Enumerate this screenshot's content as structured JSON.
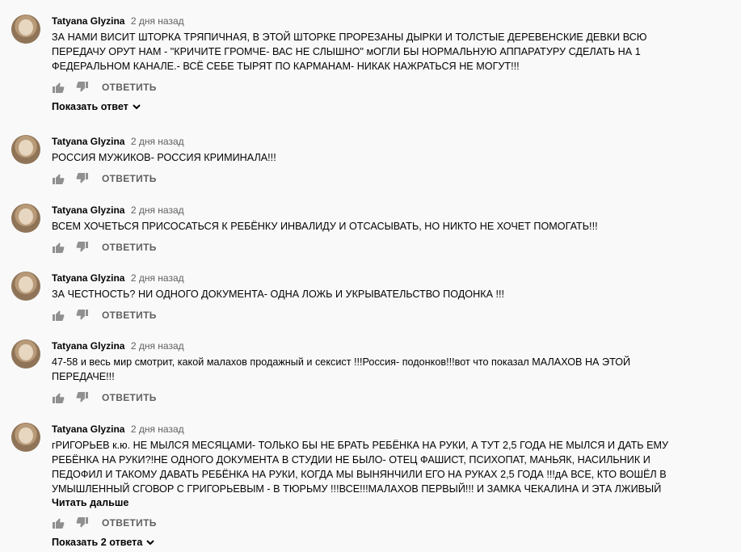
{
  "comments": [
    {
      "author": "Tatyana Glyzina",
      "time": "2 дня назад",
      "lines": [
        "ЗА НАМИ ВИСИТ ШТОРКА ТРЯПИЧНАЯ, В ЭТОЙ ШТОРКЕ ПРОРЕЗАНЫ ДЫРКИ И ТОЛСТЫЕ ДЕРЕВЕНСКИЕ ДЕВКИ ВСЮ",
        "ПЕРЕДАЧУ ОРУТ НАМ - \"КРИЧИТЕ ГРОМЧЕ- ВАС НЕ СЛЫШНО\" мОГЛИ БЫ НОРМАЛЬНУЮ АППАРАТУРУ СДЕЛАТЬ НА 1",
        "ФЕДЕРАЛЬНОМ КАНАЛЕ.- ВСЁ СЕБЕ ТЫРЯТ ПО КАРМАНАМ- НИКАК НАЖРАТЬСЯ НЕ МОГУТ!!!"
      ],
      "reply_label": "ОТВЕТИТЬ",
      "replies_label": "Показать ответ"
    },
    {
      "author": "Tatyana Glyzina",
      "time": "2 дня назад",
      "lines": [
        "РОССИЯ МУЖИКОВ- РОССИЯ КРИМИНАЛА!!!"
      ],
      "reply_label": "ОТВЕТИТЬ"
    },
    {
      "author": "Tatyana Glyzina",
      "time": "2 дня назад",
      "lines": [
        "ВСЕМ ХОЧЕТЬСЯ ПРИСОСАТЬСЯ К РЕБЁНКУ ИНВАЛИДУ И ОТСАСЫВАТЬ, НО НИКТО НЕ ХОЧЕТ ПОМОГАТЬ!!!"
      ],
      "reply_label": "ОТВЕТИТЬ"
    },
    {
      "author": "Tatyana Glyzina",
      "time": "2 дня назад",
      "lines": [
        "ЗА ЧЕСТНОСТЬ? НИ ОДНОГО ДОКУМЕНТА- ОДНА ЛОЖЬ И УКРЫВАТЕЛЬСТВО ПОДОНКА !!!"
      ],
      "reply_label": "ОТВЕТИТЬ"
    },
    {
      "author": "Tatyana Glyzina",
      "time": "2 дня назад",
      "lines": [
        "47-58  и весь мир смотрит, какой малахов продажный и сексист !!!Россия- подонков!!!вот что показал МАЛАХОВ НА ЭТОЙ",
        "ПЕРЕДАЧЕ!!!"
      ],
      "reply_label": "ОТВЕТИТЬ"
    },
    {
      "author": "Tatyana Glyzina",
      "time": "2 дня назад",
      "lines": [
        "гРИГОРЬЕВ к.ю. НЕ МЫЛСЯ МЕСЯЦАМИ- ТОЛЬКО БЫ НЕ БРАТЬ РЕБЁНКА НА РУКИ, А ТУТ 2,5 ГОДА НЕ МЫЛСЯ И ДАТЬ ЕМУ",
        "РЕБЁНКА НА РУКИ?!НЕ ОДНОГО ДОКУМЕНТА В СТУДИИ НЕ БЫЛО- ОТЕЦ ФАШИСТ, ПСИХОПАТ, МАНЬЯК, НАСИЛЬНИК И",
        "ПЕДОФИЛ  И ТАКОМУ ДАВАТЬ РЕБЁНКА НА РУКИ, КОГДА МЫ ВЫНЯНЧИЛИ ЕГО НА РУКАХ 2,5 ГОДА !!!дА ВСЕ, КТО ВОШЁЛ В",
        "УМЫШЛЕННЫЙ СГОВОР С ГРИГОРЬЕВЫМ - В ТЮРЬМУ !!!ВСЕ!!!МАЛАХОВ ПЕРВЫЙ!!! И ЗАМКА ЧЕКАЛИНА И ЭТА ЛЖИВЫЙ"
      ],
      "read_more": "Читать дальше",
      "reply_label": "ОТВЕТИТЬ",
      "replies_label": "Показать 2 ответа"
    }
  ],
  "icons": {
    "like": "thumbs-up-icon",
    "dislike": "thumbs-down-icon",
    "expand": "chevron-down-icon"
  },
  "colors": {
    "background": "#f9f9f9",
    "text": "#030303",
    "secondary": "#606060",
    "icon": "#909090"
  }
}
